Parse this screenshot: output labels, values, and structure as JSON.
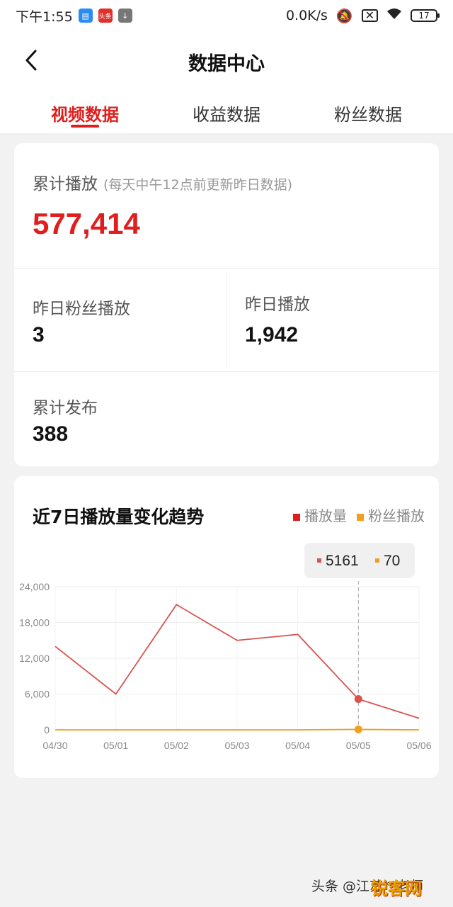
{
  "status": {
    "time": "下午1:55",
    "app_badge_2": "头条",
    "net_speed": "0.0K/s",
    "battery": "17"
  },
  "header": {
    "title": "数据中心",
    "tabs": [
      "视频数据",
      "收益数据",
      "粉丝数据"
    ],
    "active_tab": 0
  },
  "summary": {
    "total_play_label": "累计播放",
    "total_play_note": "(每天中午12点前更新昨日数据)",
    "total_play_value": "577,414",
    "yesterday_fan_play_label": "昨日粉丝播放",
    "yesterday_fan_play_value": "3",
    "yesterday_play_label": "昨日播放",
    "yesterday_play_value": "1,942",
    "total_published_label": "累计发布",
    "total_published_value": "388"
  },
  "chart": {
    "title": "近7日播放量变化趋势",
    "legend": [
      "播放量",
      "粉丝播放"
    ],
    "tooltip": {
      "play": "5161",
      "fan_play": "70"
    }
  },
  "chart_data": {
    "type": "line",
    "x": [
      "04/30",
      "05/01",
      "05/02",
      "05/03",
      "05/04",
      "05/05",
      "05/06"
    ],
    "series": [
      {
        "name": "播放量",
        "color": "#d9534f",
        "values": [
          14000,
          6000,
          21000,
          15000,
          16000,
          5161,
          1942
        ]
      },
      {
        "name": "粉丝播放",
        "color": "#f0a020",
        "values": [
          0,
          0,
          0,
          0,
          0,
          70,
          3
        ]
      }
    ],
    "ylim": [
      0,
      24000
    ],
    "yticks": [
      "0",
      "6,000",
      "12,000",
      "18,000",
      "24,000"
    ],
    "ytick_values": [
      0,
      6000,
      12000,
      18000,
      24000
    ],
    "highlight_index": 5,
    "grid": true
  },
  "watermark": {
    "text": "头条 @江苏**老师",
    "logo": "锐客网"
  },
  "colors": {
    "accent": "#e01e1e",
    "line_play": "#d9534f",
    "line_fan": "#f0a020"
  }
}
